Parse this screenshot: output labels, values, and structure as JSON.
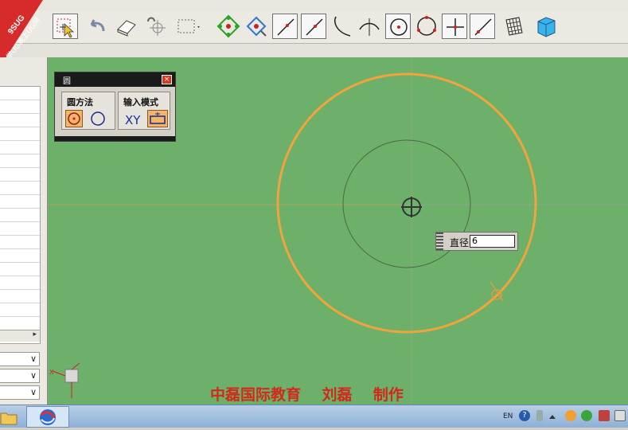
{
  "badge": {
    "line1": "9SUG",
    "line2": "学UG就上UG网"
  },
  "circle_dialog": {
    "title": "圆",
    "close_glyph": "×",
    "method_group": {
      "label": "圆方法",
      "options": [
        "center-point-circle-icon",
        "three-point-circle-icon"
      ],
      "selected": 0
    },
    "input_group": {
      "label": "输入模式",
      "xy_label": "XY",
      "options": [
        "coordinate-mode",
        "parameter-mode-icon"
      ],
      "selected": 1
    }
  },
  "diameter": {
    "label": "直径",
    "value": "6"
  },
  "credit": "中磊国际教育    刘磊    制作",
  "taskbar": {
    "lang": "EN",
    "help": "?"
  },
  "colors": {
    "canvas": "#6db06a",
    "circle": "#f2a43c",
    "selection": "#f2b56b"
  },
  "toolbar_icons": [
    "select-filter-icon",
    "undo-icon",
    "eraser-icon",
    "snap-icon",
    "rectangle-select-icon",
    "point-constructor-icon",
    "transform-icon",
    "line-icon",
    "line-through-point-icon",
    "arc-icon",
    "tangent-icon",
    "circle-icon",
    "circle-three-point-icon",
    "cross-icon",
    "slanted-line-icon",
    "grid-icon",
    "cube-icon"
  ]
}
